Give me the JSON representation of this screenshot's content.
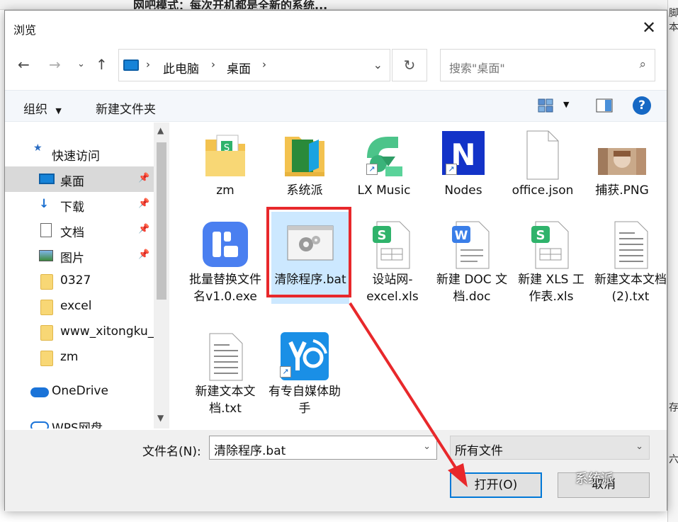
{
  "background": {
    "title_fragment": "网吧模式：每次开机都是全新的系统...",
    "side_texts": [
      "脚本",
      "存",
      "六"
    ]
  },
  "dialog": {
    "title": "浏览",
    "close_glyph": "✕"
  },
  "nav": {
    "breadcrumbs": [
      "此电脑",
      "桌面"
    ],
    "search_placeholder": "搜索\"桌面\""
  },
  "toolbar": {
    "organize": "组织",
    "new_folder": "新建文件夹",
    "help": "?"
  },
  "sidebar": {
    "items": [
      {
        "label": "快速访问",
        "icon": "star-icon"
      },
      {
        "label": "桌面",
        "icon": "desktop-icon",
        "pinned": true,
        "selected": true
      },
      {
        "label": "下载",
        "icon": "download-icon",
        "pinned": true
      },
      {
        "label": "文档",
        "icon": "document-icon",
        "pinned": true
      },
      {
        "label": "图片",
        "icon": "picture-icon",
        "pinned": true
      },
      {
        "label": "0327",
        "icon": "folder-icon"
      },
      {
        "label": "excel",
        "icon": "folder-icon"
      },
      {
        "label": "www_xitongku_c",
        "icon": "folder-icon"
      },
      {
        "label": "zm",
        "icon": "folder-icon"
      },
      {
        "label": "OneDrive",
        "icon": "cloud-icon"
      },
      {
        "label": "WPS网盘",
        "icon": "cloud-icon"
      }
    ]
  },
  "files": [
    {
      "name": "zm",
      "icon": "folder-icon"
    },
    {
      "name": "系统派",
      "icon": "folder-icon"
    },
    {
      "name": "LX Music",
      "icon": "music-app-icon"
    },
    {
      "name": "Nodes",
      "icon": "nodes-app-icon"
    },
    {
      "name": "office.json",
      "icon": "blank-file-icon"
    },
    {
      "name": "捕获.PNG",
      "icon": "image-thumbnail-icon"
    },
    {
      "name": "批量替换文件名v1.0.exe",
      "icon": "exe-app-icon"
    },
    {
      "name": "清除程序.bat",
      "icon": "batch-file-icon",
      "selected": true
    },
    {
      "name": "设站网-excel.xls",
      "icon": "xls-file-icon"
    },
    {
      "name": "新建 DOC 文档.doc",
      "icon": "doc-file-icon"
    },
    {
      "name": "新建 XLS 工作表.xls",
      "icon": "xls-file-icon"
    },
    {
      "name": "新建文本文档 (2).txt",
      "icon": "txt-file-icon"
    },
    {
      "name": "新建文本文档.txt",
      "icon": "txt-file-icon"
    },
    {
      "name": "有专自媒体助手",
      "icon": "media-app-icon"
    }
  ],
  "bottom": {
    "filename_label": "文件名(N):",
    "filename_value": "清除程序.bat",
    "filter_value": "所有文件",
    "open_button": "打开(O)",
    "cancel_button": "取消"
  },
  "watermark": "系统派",
  "colors": {
    "accent": "#0078d7",
    "highlight_red": "#e8282b",
    "selection": "#cce8ff"
  }
}
